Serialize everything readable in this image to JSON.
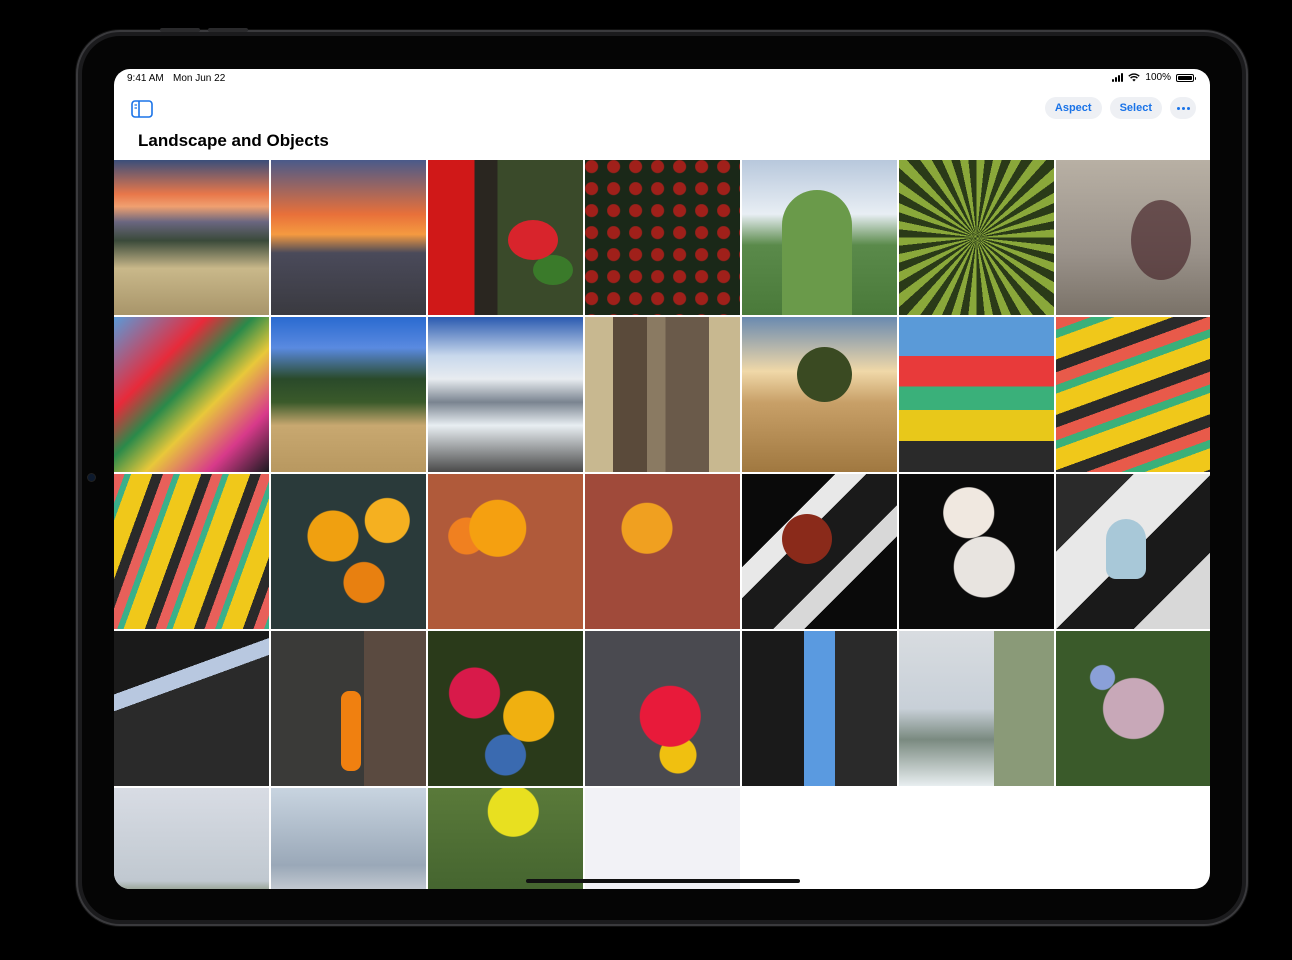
{
  "status_bar": {
    "time": "9:41 AM",
    "date": "Mon Jun 22",
    "battery": "100%"
  },
  "toolbar": {
    "aspect_label": "Aspect",
    "select_label": "Select"
  },
  "page": {
    "title": "Landscape and Objects"
  },
  "add_tile": {
    "icon": "+"
  },
  "photos": [
    "sunset-hills",
    "city-sunset",
    "red-fabric-flowers",
    "red-berries",
    "cactus",
    "agave",
    "hanging-plants",
    "papel-picado",
    "meadow-trees",
    "snowy-volcano",
    "tree-trunks",
    "lone-tree",
    "stadium-seats-1",
    "stadium-seats-2",
    "stadium-seats-3",
    "marigolds-1",
    "marigolds-2",
    "marigolds-3",
    "flowers-shadow",
    "teacup",
    "vase",
    "market-stalls",
    "orange-bottle",
    "flower-bouquet",
    "flower-bucket",
    "narrow-street",
    "sea-fabric",
    "borage",
    "yellow-flowers-sea",
    "balustrade",
    "yellow-wildflowers"
  ],
  "colors": {
    "accent": "#1a73e8",
    "pill_bg": "#eef0f4"
  }
}
